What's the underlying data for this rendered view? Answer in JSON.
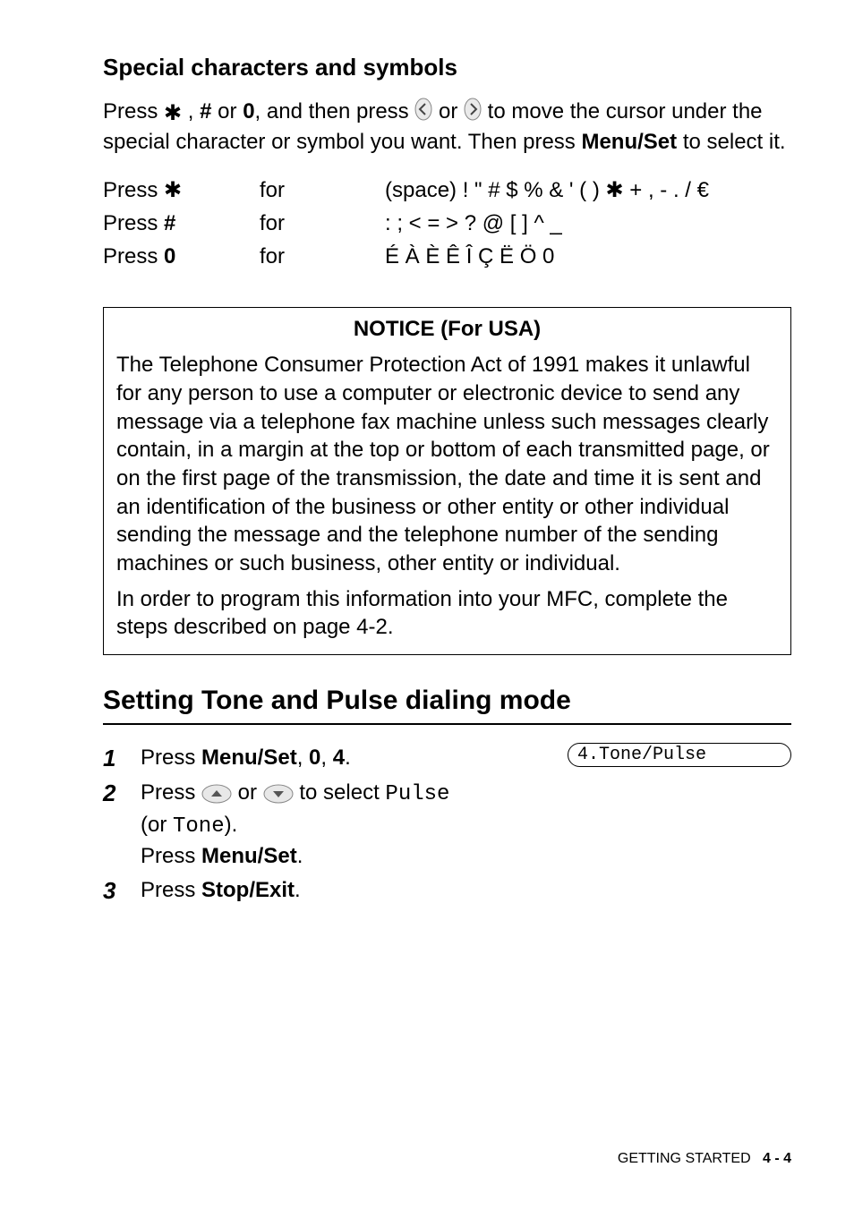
{
  "sub_heading": "Special characters and symbols",
  "intro_para": {
    "p1": "Press ",
    "star": "✱",
    "p2": " , ",
    "hash": "#",
    "p3": " or ",
    "zero": "0",
    "p4": ", and then press ",
    "p5": " or ",
    "p6": " to move the cursor under the special character or symbol you want. Then press ",
    "menu": "Menu/Set",
    "p7": " to select it."
  },
  "rows": [
    {
      "c1a": "Press ",
      "c1b": "✱",
      "c2": "for",
      "c3": "(space) ! \" # $ % & ' ( )  ✱  + , - . / €"
    },
    {
      "c1a": "Press ",
      "c1b": "#",
      "c2": "for",
      "c3": ": ; < = > ? @ [ ] ^ _"
    },
    {
      "c1a": "Press ",
      "c1b": "0",
      "c2": "for",
      "c3": "É À È Ê Î Ç Ë Ö 0"
    }
  ],
  "notice": {
    "title": "NOTICE (For USA)",
    "para1": "The Telephone Consumer Protection Act of 1991 makes it unlawful for any person to use a computer or electronic device to send any message via a telephone fax machine unless such messages clearly contain, in a margin at the top or bottom of each transmitted page, or on the first page of the transmission, the date and time it is sent and an identification of the business or other entity or other individual sending the message and the telephone number of the sending machines or such business, other entity or individual.",
    "para2": "In order to program this information into your MFC, complete the steps described on page 4-2."
  },
  "section_heading": "Setting Tone and Pulse dialing mode",
  "lcd": "4.Tone/Pulse",
  "steps": {
    "s1": {
      "num": "1",
      "a": "Press ",
      "b": "Menu/Set",
      "c": ", ",
      "d": "0",
      "e": ", ",
      "f": "4",
      "g": "."
    },
    "s2": {
      "num": "2",
      "a": "Press ",
      "b": " or ",
      "c": " to select ",
      "d": "Pulse",
      "e": "(or ",
      "f": "Tone",
      "g": ").",
      "h": "Press ",
      "i": "Menu/Set",
      "j": "."
    },
    "s3": {
      "num": "3",
      "a": "Press ",
      "b": "Stop/Exit",
      "c": "."
    }
  },
  "footer": {
    "label": "GETTING STARTED",
    "page": "4 - 4"
  }
}
